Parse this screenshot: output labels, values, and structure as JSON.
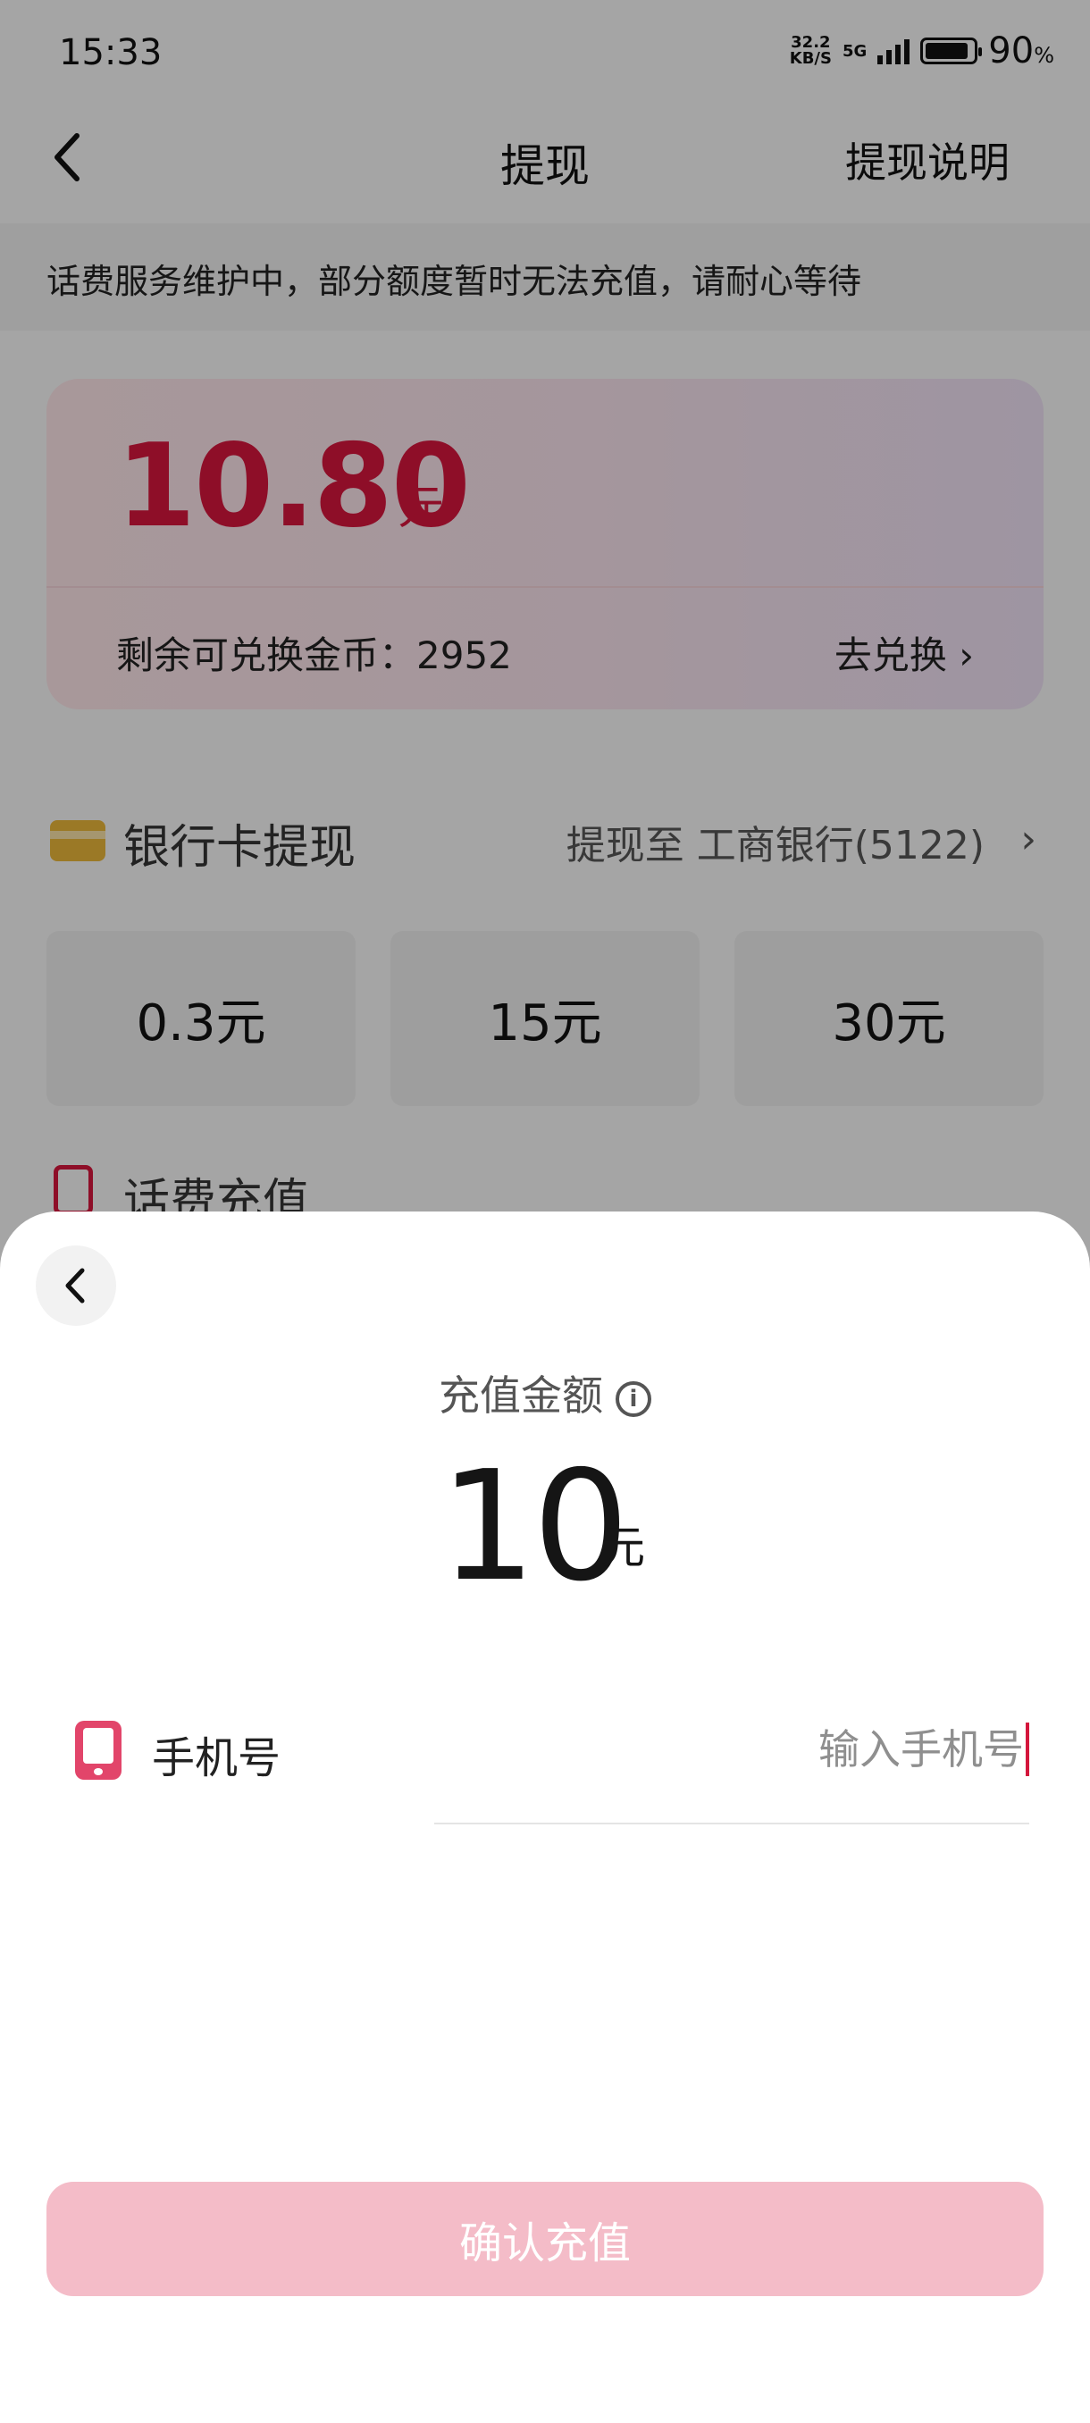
{
  "status_bar": {
    "time": "15:33",
    "net_speed_value": "32.2",
    "net_speed_unit": "KB/S",
    "network_type": "5G",
    "battery_level": 0.9,
    "battery_percent": "90",
    "battery_percent_sign": "%"
  },
  "header": {
    "title": "提现",
    "help_link": "提现说明"
  },
  "notice": {
    "text": "话费服务维护中，部分额度暂时无法充值，请耐心等待"
  },
  "balance": {
    "amount": "10.80",
    "unit": "元",
    "coins_label": "剩余可兑换金币：2952",
    "exchange_link": "去兑换 ›"
  },
  "bank_withdraw": {
    "title": "银行卡提现",
    "target": "提现至 工商银行(5122)",
    "options": [
      "0.3元",
      "15元",
      "30元"
    ]
  },
  "phone_recharge": {
    "title": "话费充值"
  },
  "sheet": {
    "amount_label": "充值金额",
    "amount": "10",
    "unit": "元",
    "phone_label": "手机号",
    "phone_placeholder": "输入手机号",
    "confirm_button": "确认充值"
  },
  "colors": {
    "accent": "#d4163c",
    "confirm_disabled": "#f4bcc8",
    "bank_icon": "#e8b53a"
  }
}
